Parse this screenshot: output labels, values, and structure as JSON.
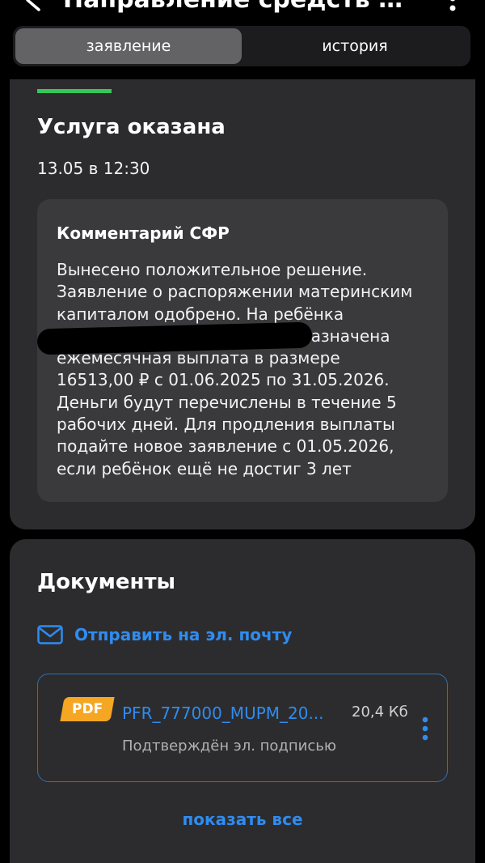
{
  "header": {
    "title": "Направление средств мате...",
    "back_icon": "chevron-left-icon",
    "more_icon": "more-vertical-icon"
  },
  "tabs": [
    {
      "label": "заявление",
      "active": true
    },
    {
      "label": "история",
      "active": false
    }
  ],
  "status": {
    "title": "Услуга оказана",
    "time": "13.05 в 12:30",
    "color": "#34c759"
  },
  "comment": {
    "title": "Комментарий СФР",
    "lines": [
      "Вынесено положительное решение.",
      "Заявление о распоряжении материнским",
      "капиталом одобрено. На ребёнка",
      "Д                                             назначена",
      "ежемесячная выплата в размере",
      "16513,00 ₽ с 01.06.2025 по 31.05.2026.",
      "Деньги будут перечислены в течение 5",
      "рабочих дней. Для продления выплаты",
      "подайте новое заявление с 01.05.2026,",
      "если ребёнок ещё не достиг 3 лет"
    ]
  },
  "documents": {
    "title": "Документы",
    "email_label": "Отправить на эл. почту",
    "email_icon": "mail-icon",
    "items": [
      {
        "badge": "PDF",
        "name": "PFR_777000_MUPM_20...",
        "size": "20,4 Кб",
        "status": "Подтверждён эл. подписью"
      }
    ],
    "show_all_label": "показать все"
  },
  "colors": {
    "accent": "#2f8cf0",
    "pdf_badge": "#f5a623",
    "card_bg": "#2c2c2e"
  }
}
